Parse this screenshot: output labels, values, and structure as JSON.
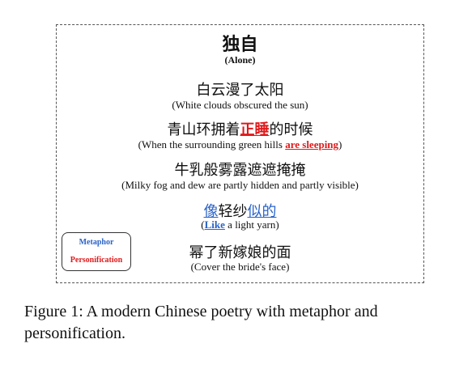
{
  "poem": {
    "title_cn": "独自",
    "title_en": "(Alone)",
    "lines": [
      {
        "cn": "白云漫了太阳",
        "en": "(White clouds obscured the sun)"
      },
      {
        "cn_pre": "青山环拥着",
        "cn_hl": "正睡",
        "cn_post": "的时候",
        "en_pre": "(When the surrounding green hills ",
        "en_hl": "are sleeping",
        "en_post": ")"
      },
      {
        "cn": "牛乳般雾露遮遮掩掩",
        "en": "(Milky fog and dew are partly hidden and partly visible)"
      },
      {
        "cn_hl1": "像",
        "cn_mid": "轻纱",
        "cn_hl2": "似的",
        "en_pre": "(",
        "en_hl": "Like",
        "en_post": " a light yarn)"
      },
      {
        "cn": "幂了新嫁娘的面",
        "en": "(Cover the bride's face)"
      }
    ]
  },
  "legend": {
    "metaphor": "Metaphor",
    "personification": "Personification"
  },
  "colors": {
    "metaphor": "#2a63c8",
    "personification": "#e0191b"
  },
  "caption": "Figure 1: A modern Chinese poetry with metaphor and personification."
}
